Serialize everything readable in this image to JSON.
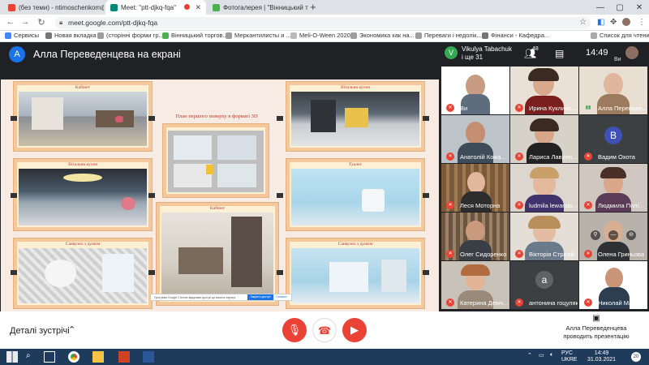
{
  "browser": {
    "tabs": [
      {
        "title": "(без теми) - ntimoschenkom@g",
        "active": false
      },
      {
        "title": "Meet: \"ptt-djkq-fqa\"",
        "active": true
      },
      {
        "title": "Фотогалерея | \"Вінницький торг",
        "active": false
      }
    ],
    "new_tab": "+",
    "url": "meet.google.com/ptt-djkq-fqa",
    "bookmarks": [
      "Сервисы",
      "Новая вкладка",
      "(сторінні форми гр...",
      "Вінницький торгов...",
      "Меркантилисты и ...",
      "Meli-O-Ween 2020",
      "Экономика как на...",
      "Переваги і недолік...",
      "Фінанси - Кафедра..."
    ],
    "bookmarks_right": "Список для чтения"
  },
  "meet": {
    "presenter_initial": "A",
    "present_title": "Алла Переведенцева на екрані",
    "vikulya_initial": "V",
    "vikulya_line1": "Vikulya Tabachuk",
    "vikulya_line2": "і ще 31",
    "people_count": "48",
    "clock": "14:49",
    "me_label": "Ви"
  },
  "slide": {
    "title": "План першого поверху в форматі 3D",
    "photos": [
      {
        "caption": "Кабінет"
      },
      {
        "caption": "Вітальня кухня"
      },
      {
        "caption": "Санвузол з душем"
      },
      {
        "caption": ""
      },
      {
        "caption": "Кабінет"
      },
      {
        "caption": "Вітальня кухня"
      },
      {
        "caption": "Туалет"
      },
      {
        "caption": "Санвузол з душем"
      }
    ],
    "share_text": "Програма Google Chrome відкриває доступ до вашого екрана.",
    "share_button": "Закрити доступ",
    "share_hide": "Сховати"
  },
  "participants": [
    {
      "name": "Ви",
      "mic": "off"
    },
    {
      "name": "Ирина Куклинс...",
      "mic": "off"
    },
    {
      "name": "Алла Переведе...",
      "mic": "on"
    },
    {
      "name": "Анатолій Кожа...",
      "mic": "off"
    },
    {
      "name": "Лариса Лаврен...",
      "mic": "off"
    },
    {
      "name": "Вадим Охота",
      "mic": "off",
      "initial": "В"
    },
    {
      "name": "Леся Моторна",
      "mic": "off"
    },
    {
      "name": "ludmila lewando...",
      "mic": "off"
    },
    {
      "name": "Людмила Полі...",
      "mic": "off"
    },
    {
      "name": "Олег Сидоренко",
      "mic": "off"
    },
    {
      "name": "Вікторія Стратій",
      "mic": "off"
    },
    {
      "name": "Олена Гриньова",
      "mic": "off"
    },
    {
      "name": "Катерина Демч...",
      "mic": "off"
    },
    {
      "name": "антонина гоцуляк",
      "mic": "off",
      "initial": "a"
    },
    {
      "name": "Николай Машт...",
      "mic": "off"
    }
  ],
  "callbar": {
    "details": "Деталі зустрічі",
    "presenter_line1": "Алла Переведенцева",
    "presenter_line2": "проводить презентацію"
  },
  "taskbar": {
    "lang1": "РУС",
    "lang2": "UKRE",
    "time": "14:49",
    "date": "31.03.2021",
    "notifications": "20"
  },
  "colors": {
    "meet_bg": "#202124",
    "mic_off": "#ea4335",
    "accent": "#1a73e8",
    "taskbar": "#1f3b5c"
  }
}
